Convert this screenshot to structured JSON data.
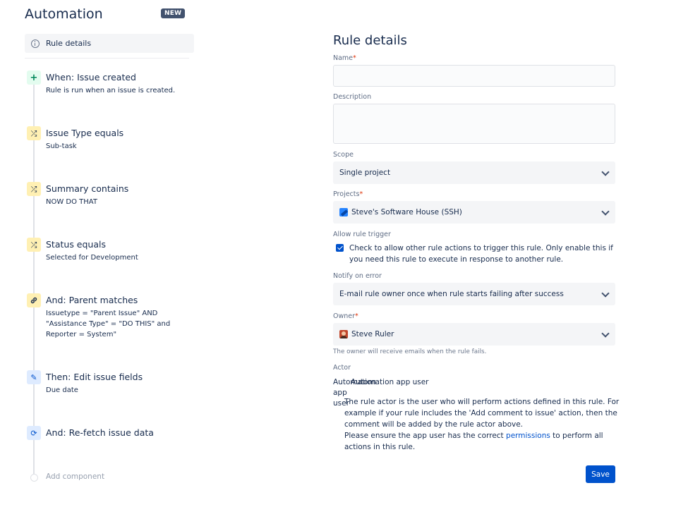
{
  "app": {
    "title": "Automation",
    "badge": "NEW"
  },
  "sidebar": {
    "rule_details_label": "Rule details",
    "steps": [
      {
        "kind": "trigger",
        "icon": "plus-icon",
        "glyph": "+",
        "title": "When: Issue created",
        "desc": "Rule is run when an issue is created."
      },
      {
        "kind": "condition",
        "icon": "shuffle-icon",
        "glyph": "⤮",
        "title": "Issue Type equals",
        "desc": "Sub-task"
      },
      {
        "kind": "condition",
        "icon": "shuffle-icon",
        "glyph": "⤮",
        "title": "Summary contains",
        "desc": "NOW DO THAT"
      },
      {
        "kind": "condition",
        "icon": "shuffle-icon",
        "glyph": "⤮",
        "title": "Status equals",
        "desc": "Selected for Development"
      },
      {
        "kind": "condition",
        "icon": "link-icon",
        "glyph": "🔗",
        "title": "And: Parent matches",
        "desc": "Issuetype = \"Parent Issue\" AND \"Assistance Type\" = \"DO THIS\" and Reporter = System\""
      },
      {
        "kind": "action",
        "icon": "pencil-icon",
        "glyph": "✎",
        "title": "Then: Edit issue fields",
        "desc": "Due date"
      },
      {
        "kind": "action",
        "icon": "refresh-icon",
        "glyph": "⟳",
        "title": "And: Re-fetch issue data",
        "desc": ""
      }
    ],
    "add_component_label": "Add component"
  },
  "form": {
    "title": "Rule details",
    "name": {
      "label": "Name",
      "required": "*",
      "value": ""
    },
    "description": {
      "label": "Description",
      "value": ""
    },
    "scope": {
      "label": "Scope",
      "value": "Single project"
    },
    "projects": {
      "label": "Projects",
      "required": "*",
      "value": "Steve's Software House (SSH)"
    },
    "allow_trigger": {
      "label": "Allow rule trigger",
      "checked": true,
      "text": "Check to allow other rule actions to trigger this rule. Only enable this if you need this rule to execute in response to another rule."
    },
    "notify": {
      "label": "Notify on error",
      "value": "E-mail rule owner once when rule starts failing after success"
    },
    "owner": {
      "label": "Owner",
      "required": "*",
      "value": "Steve Ruler",
      "helper": "The owner will receive emails when the rule fails."
    },
    "actor": {
      "label": "Actor",
      "broken_label": "Automation app user",
      "value": "Automation app user",
      "help_line1": "The rule actor is the user who will perform actions defined in this rule. For example if your rule includes the 'Add comment to issue' action, then the comment will be added by the rule actor above.",
      "help_pre": "Please ensure the app user has the correct ",
      "help_link": "permissions",
      "help_post": " to perform all actions in this rule."
    },
    "save_label": "Save"
  }
}
